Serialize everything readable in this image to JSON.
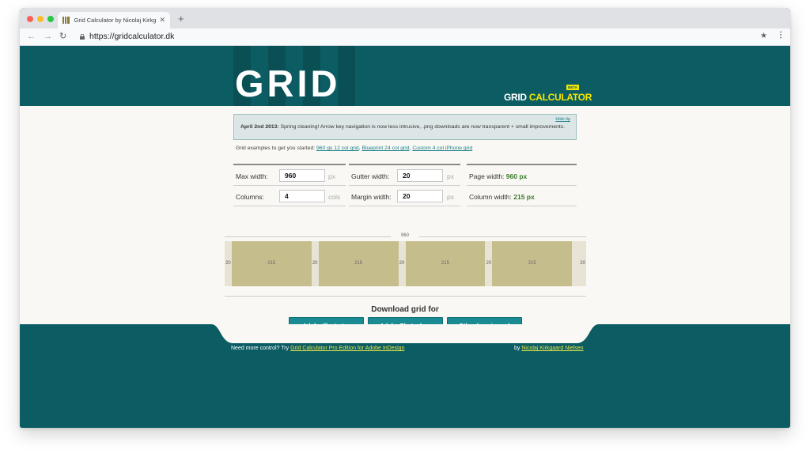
{
  "browser": {
    "tab_title": "Grid Calculator by Nicolaj Kirkga",
    "url": "https://gridcalculator.dk",
    "colors": {
      "close": "#ff5f57",
      "minimize": "#febc2e",
      "maximize": "#28c840"
    }
  },
  "header": {
    "logo_text": "GRID",
    "brand_grid": "GRID",
    "brand_calculator": "CALCULATOR",
    "beta_badge": "BETA"
  },
  "tip": {
    "hide_label": "Hide tip",
    "date": "April 2nd 2013:",
    "message": "Spring cleaning! Arrow key navigation is now less intrusive, .png downloads are now transparent + small improvements."
  },
  "examples": {
    "intro": "Grid examples to get you started:",
    "links": [
      "960 gs 12 col grid",
      "Blueprint 24 col grid",
      "Custom 4 col iPhone grid"
    ]
  },
  "form": {
    "max_width": {
      "label": "Max width:",
      "value": "960",
      "unit": "px"
    },
    "columns": {
      "label": "Columns:",
      "value": "4",
      "unit": "cols"
    },
    "gutter_width": {
      "label": "Gutter width:",
      "value": "20",
      "unit": "px"
    },
    "margin_width": {
      "label": "Margin width:",
      "value": "20",
      "unit": "px"
    },
    "page_width": {
      "label": "Page width:",
      "value": "960 px"
    },
    "column_width": {
      "label": "Column width:",
      "value": "215 px"
    }
  },
  "grid_preview": {
    "total": "960",
    "margin": "20",
    "gutter": "20",
    "column": "215"
  },
  "download": {
    "title": "Download grid for",
    "buttons": [
      "Adobe Illustrator",
      "Adobe Photoshop",
      "Other (png image)"
    ]
  },
  "footer": {
    "prompt": "Need more control? Try",
    "pro_link": "Grid Calculator Pro Edition for Adobe InDesign",
    "by": "by",
    "author_link": "Nicolaj Kirkgaard Nielsen"
  }
}
